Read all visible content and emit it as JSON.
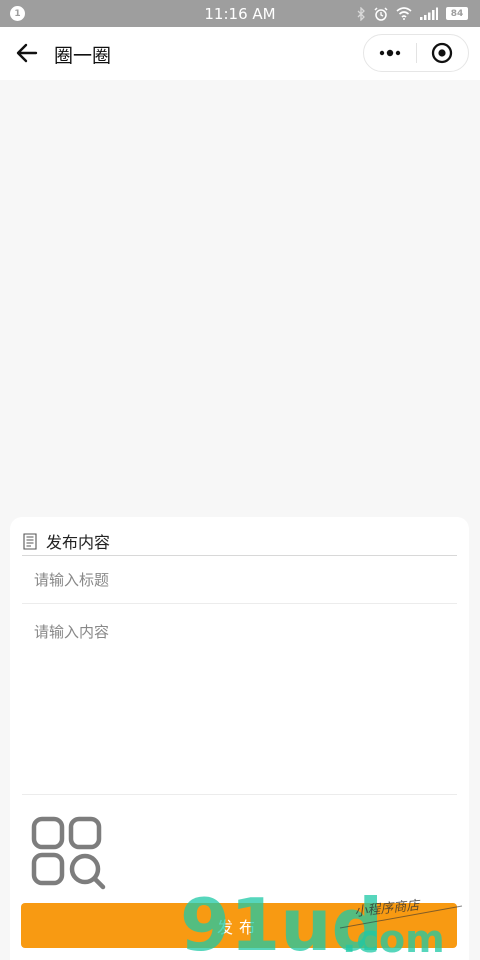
{
  "status_bar": {
    "notification_badge": "1",
    "time": "11:16 AM",
    "battery": "84",
    "icons": [
      "bluetooth-icon",
      "alarm-icon",
      "wifi-icon",
      "signal-icon",
      "battery-icon"
    ]
  },
  "nav": {
    "title": "圈一圈",
    "back_icon": "arrow-left-icon",
    "menu_icon": "more-dots-icon",
    "close_icon": "target-circle-icon"
  },
  "form": {
    "section_title": "发布内容",
    "title_placeholder": "请输入标题",
    "content_placeholder": "请输入内容",
    "image_picker_icon": "image-gallery-icon",
    "publish_label": "发布"
  },
  "watermark": {
    "text_large": "91ud",
    "text_com": ".com",
    "text_small": "小程序商店"
  },
  "colors": {
    "accent": "#f89a12",
    "page_bg": "#f7f7f7",
    "status_bar": "#9e9e9e"
  }
}
